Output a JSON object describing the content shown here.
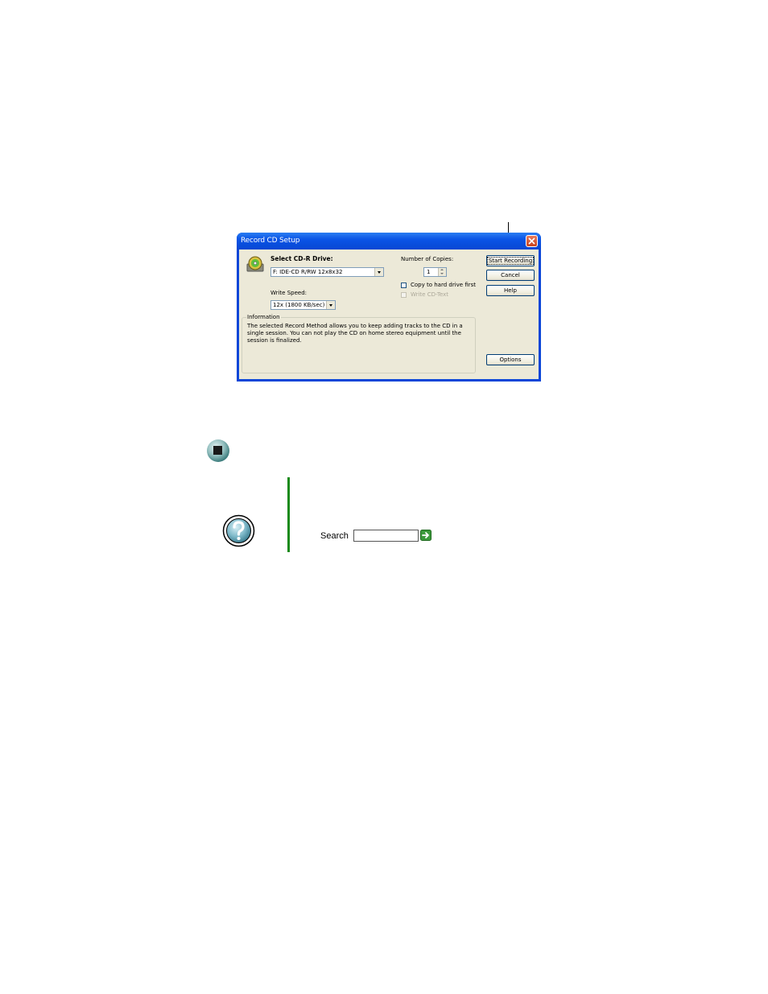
{
  "dialog": {
    "title": "Record CD Setup",
    "select_drive_label": "Select CD-R Drive:",
    "drive_value": "F: IDE-CD R/RW 12x8x32",
    "write_speed_label": "Write Speed:",
    "write_speed_value": "12x (1800 KB/sec)",
    "copies_label": "Number of Copies:",
    "copies_value": "1",
    "copy_to_hard_drive_label": "Copy to hard drive first",
    "write_cd_text_label": "Write CD-Text",
    "buttons": {
      "start_recording": "Start Recording",
      "cancel": "Cancel",
      "help": "Help",
      "options": "Options"
    },
    "info_legend": "Information",
    "info_text": "The selected Record Method allows you to keep adding tracks to the CD in a single session. You can not play the CD on home stereo equipment until the session is finalized."
  },
  "help_box": {
    "search_label": "Search",
    "search_value": ""
  },
  "colors": {
    "title_bar": "#0a54e6",
    "dialog_face": "#ece9d8",
    "close_button": "#d9532c",
    "green_bar": "#1a8a1a"
  },
  "icons": [
    "cd-drive-icon",
    "close-icon",
    "stop-icon",
    "help-icon",
    "go-arrow-icon"
  ]
}
